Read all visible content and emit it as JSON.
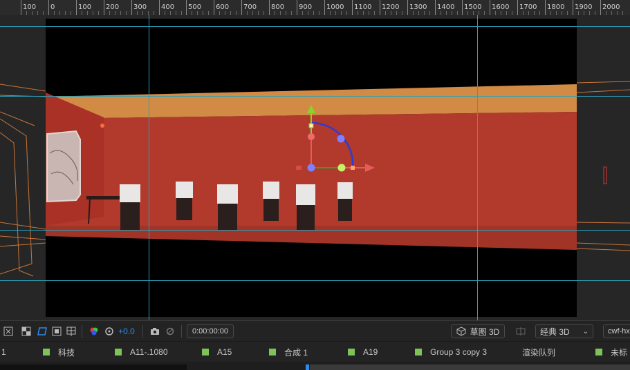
{
  "ruler": {
    "labels": [
      "100",
      "0",
      "100",
      "200",
      "300",
      "400",
      "500",
      "600",
      "700",
      "800",
      "900",
      "1000",
      "1100",
      "1200",
      "1300",
      "1400",
      "1500",
      "1600",
      "1700",
      "1800",
      "1900",
      "2000"
    ]
  },
  "toolbar": {
    "exposure_value": "+0.0",
    "timecode": "0:00:00:00",
    "draft3d_label": "草图 3D",
    "renderer_label": "经典 3D",
    "renderer_caret": "⌄",
    "camera_label": "cwf-hx"
  },
  "tabs": [
    {
      "label": "1",
      "color": "#7dc35a",
      "has_square": false
    },
    {
      "label": "科技",
      "color": "#7dc35a",
      "has_square": true
    },
    {
      "label": "A11-.1080",
      "color": "#7dc35a",
      "has_square": true
    },
    {
      "label": "A15",
      "color": "#7dc35a",
      "has_square": true
    },
    {
      "label": "合成 1",
      "color": "#7dc35a",
      "has_square": true
    },
    {
      "label": "A19",
      "color": "#7dc35a",
      "has_square": true
    },
    {
      "label": "Group 3 copy 3",
      "color": "#7dc35a",
      "has_square": true
    },
    {
      "label": "渲染队列",
      "color": "",
      "has_square": false
    },
    {
      "label": "未标",
      "color": "#7dc35a",
      "has_square": true
    }
  ],
  "colors": {
    "guide": "#2aa0b8",
    "tab_label": "#7dc35a",
    "wall": "#b23a2c",
    "ceiling": "#d18b45",
    "accent_blue": "#2d8ceb"
  }
}
